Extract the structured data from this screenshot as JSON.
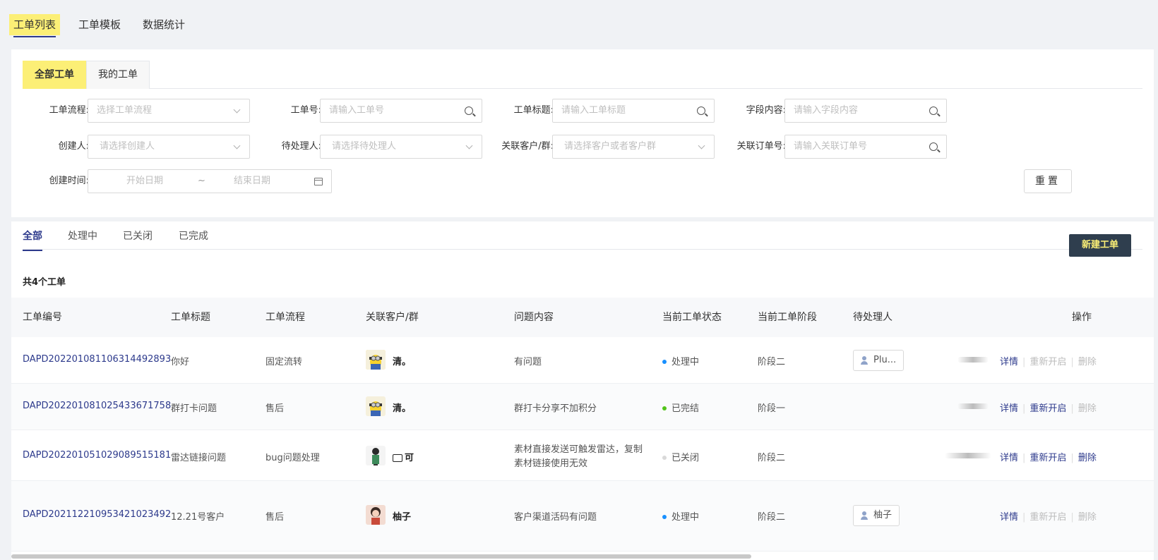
{
  "topnav": {
    "items": [
      "工单列表",
      "工单模板",
      "数据统计"
    ],
    "active": 0
  },
  "filter": {
    "subtabs": [
      "全部工单",
      "我的工单"
    ],
    "fields": {
      "flow": {
        "label": "工单流程:",
        "placeholder": "选择工单流程"
      },
      "no": {
        "label": "工单号:",
        "placeholder": "请输入工单号"
      },
      "title": {
        "label": "工单标题:",
        "placeholder": "请输入工单标题"
      },
      "field": {
        "label": "字段内容:",
        "placeholder": "请输入字段内容"
      },
      "creator": {
        "label": "创建人:",
        "placeholder": "请选择创建人"
      },
      "assignee": {
        "label": "待处理人:",
        "placeholder": "请选择待处理人"
      },
      "customer": {
        "label": "关联客户/群:",
        "placeholder": "请选择客户或者客户群"
      },
      "order": {
        "label": "关联订单号:",
        "placeholder": "请输入关联订单号"
      },
      "created": {
        "label": "创建时间:",
        "start": "开始日期",
        "sep": "~",
        "end": "结束日期"
      }
    },
    "reset_label": "重置"
  },
  "list": {
    "status_tabs": [
      "全部",
      "处理中",
      "已关闭",
      "已完成"
    ],
    "new_label": "新建工单",
    "count_text": "共4个工单",
    "columns": [
      "工单编号",
      "工单标题",
      "工单流程",
      "关联客户/群",
      "问题内容",
      "当前工单状态",
      "当前工单阶段",
      "待处理人",
      "操作"
    ],
    "rows": [
      {
        "id": "DAPD20220108110631449289​3",
        "title": "你好",
        "flow": "固定流转",
        "customer": "清。",
        "issue": "有问题",
        "status": "处理中",
        "status_color": "#1890ff",
        "stage": "阶段二",
        "assignee": "Plu..."
      },
      {
        "id": "DAPD20220108102543367175​8",
        "title": "群打卡问题",
        "flow": "售后",
        "customer": "清。",
        "issue": "群打卡分享不加积分",
        "status": "已完结",
        "status_color": "#52c41a",
        "stage": "阶段一",
        "assignee": ""
      },
      {
        "id": "DAPD20220105102908951518​1",
        "title": "雷达链接问题",
        "flow": "bug问题处理",
        "customer": "可",
        "issue": "素材直接发送可触发雷达，复制素材链接使用无效",
        "status": "已关闭",
        "status_color": "#d9d9d9",
        "stage": "阶段二",
        "assignee": ""
      },
      {
        "id": "DAPD20211221095342102349​2",
        "title": "12.21号客户",
        "flow": "售后",
        "customer": "柚子",
        "issue": "客户渠道活码有问题",
        "status": "处理中",
        "status_color": "#1890ff",
        "stage": "阶段二",
        "assignee": "柚子"
      }
    ],
    "ops": [
      "详情",
      "重新开启",
      "删除"
    ]
  }
}
